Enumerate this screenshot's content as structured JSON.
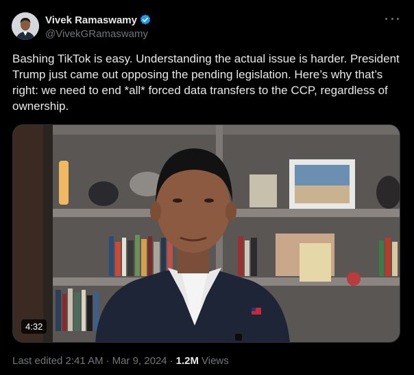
{
  "author": {
    "display_name": "Vivek Ramaswamy",
    "handle": "@VivekGRamaswamy",
    "verified_icon": "verified-badge-icon",
    "verified_color": "#1d9bf0"
  },
  "more_icon": "more-horizontal-icon",
  "tweet": {
    "text": "Bashing TikTok is easy. Understanding the actual issue is harder. President Trump just came out opposing the pending legislation. Here’s why that’s right: we need to end *all* forced data transfers to the CCP, regardless of ownership."
  },
  "media": {
    "type": "video",
    "duration": "4:32"
  },
  "meta": {
    "edited": "Last edited 2:41 AM",
    "separator": "·",
    "date": "Mar 9, 2024",
    "separator2": "·",
    "views_count": "1.2M",
    "views_label": "Views"
  },
  "colors": {
    "background": "#000000",
    "text": "#e7e9ea",
    "secondary": "#71767b"
  }
}
